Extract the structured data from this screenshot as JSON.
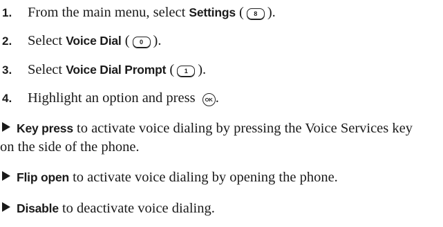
{
  "steps": [
    {
      "number": "1.",
      "pre": "From the main menu, select ",
      "bold": "Settings",
      "paren_open": " (",
      "key": "8",
      "paren_close": ")."
    },
    {
      "number": "2.",
      "pre": "Select ",
      "bold": "Voice Dial",
      "paren_open": " (",
      "key": "0",
      "paren_close": ")."
    },
    {
      "number": "3.",
      "pre": "Select ",
      "bold": "Voice Dial Prompt",
      "paren_open": " (",
      "key": "1",
      "paren_close": ")."
    },
    {
      "number": "4.",
      "pre": "Highlight an option and press ",
      "ok_key": "OK",
      "post": "."
    }
  ],
  "options": [
    {
      "bold": "Key press",
      "text": " to activate voice dialing by pressing the Voice Services key",
      "continuation": "on the side of the phone."
    },
    {
      "bold": "Flip open",
      "text": " to activate voice dialing by opening the phone."
    },
    {
      "bold": "Disable",
      "text": " to deactivate voice dialing."
    }
  ],
  "icons": {
    "keypad_key": "keypad-key-icon",
    "ok_key": "ok-key-icon",
    "bullet": "triangle-bullet-icon"
  }
}
